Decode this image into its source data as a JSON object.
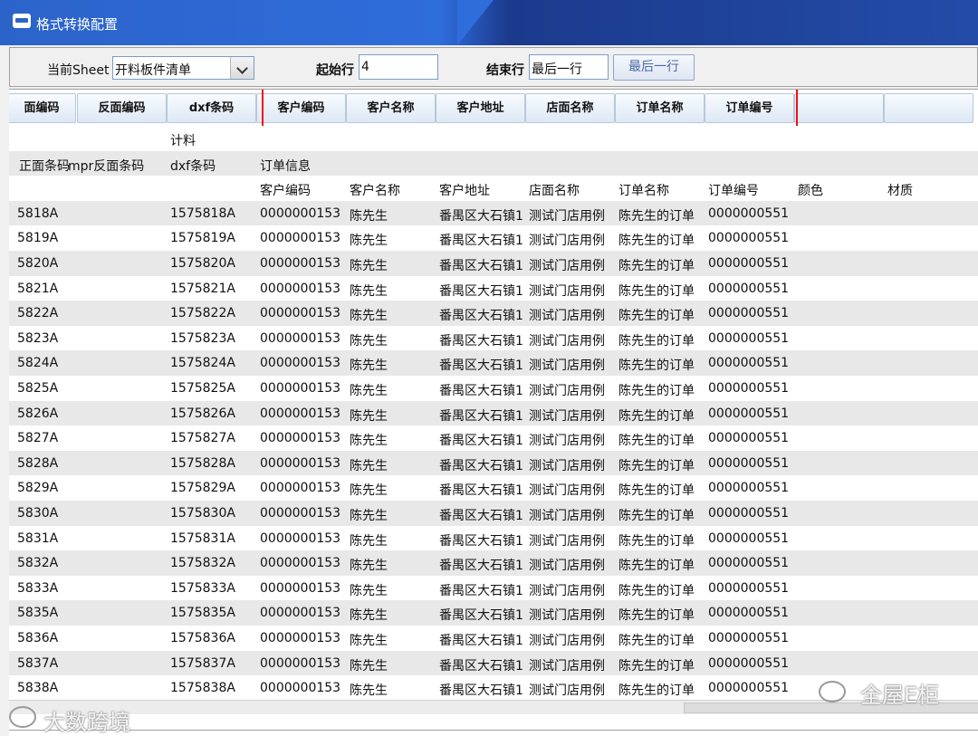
{
  "window": {
    "title": "格式转换配置"
  },
  "toolbar": {
    "sheet_label": "当前Sheet",
    "sheet_value": "开料板件清单",
    "start_label": "起始行",
    "start_value": "4",
    "end_label": "结束行",
    "end_value": "最后一行",
    "last_row_button": "最后一行"
  },
  "column_headers": [
    "面编码",
    "反面编码",
    "dxf条码",
    "客户编码",
    "客户名称",
    "客户地址",
    "店面名称",
    "订单名称",
    "订单编号",
    "",
    ""
  ],
  "header_rows": {
    "row1": {
      "c3": "计料"
    },
    "row2": {
      "c1": "正面条码",
      "c2": "mpr反面条码",
      "c3": "dxf条码",
      "c4": "订单信息"
    },
    "row3": {
      "c4": "客户编码",
      "c5": "客户名称",
      "c6": "客户地址",
      "c7": "店面名称",
      "c8": "订单名称",
      "c9": "订单编号",
      "c10": "颜色",
      "c11": "材质"
    }
  },
  "rows": [
    {
      "a": "5818A",
      "dxf": "1575818A",
      "cust_code": "0000000153",
      "cust_name": "陈先生",
      "addr": "番禺区大石镇1",
      "store": "测试门店用例",
      "order_name": "陈先生的订单",
      "order_no": "0000000551"
    },
    {
      "a": "5819A",
      "dxf": "1575819A",
      "cust_code": "0000000153",
      "cust_name": "陈先生",
      "addr": "番禺区大石镇1",
      "store": "测试门店用例",
      "order_name": "陈先生的订单",
      "order_no": "0000000551"
    },
    {
      "a": "5820A",
      "dxf": "1575820A",
      "cust_code": "0000000153",
      "cust_name": "陈先生",
      "addr": "番禺区大石镇1",
      "store": "测试门店用例",
      "order_name": "陈先生的订单",
      "order_no": "0000000551"
    },
    {
      "a": "5821A",
      "dxf": "1575821A",
      "cust_code": "0000000153",
      "cust_name": "陈先生",
      "addr": "番禺区大石镇1",
      "store": "测试门店用例",
      "order_name": "陈先生的订单",
      "order_no": "0000000551"
    },
    {
      "a": "5822A",
      "dxf": "1575822A",
      "cust_code": "0000000153",
      "cust_name": "陈先生",
      "addr": "番禺区大石镇1",
      "store": "测试门店用例",
      "order_name": "陈先生的订单",
      "order_no": "0000000551"
    },
    {
      "a": "5823A",
      "dxf": "1575823A",
      "cust_code": "0000000153",
      "cust_name": "陈先生",
      "addr": "番禺区大石镇1",
      "store": "测试门店用例",
      "order_name": "陈先生的订单",
      "order_no": "0000000551"
    },
    {
      "a": "5824A",
      "dxf": "1575824A",
      "cust_code": "0000000153",
      "cust_name": "陈先生",
      "addr": "番禺区大石镇1",
      "store": "测试门店用例",
      "order_name": "陈先生的订单",
      "order_no": "0000000551"
    },
    {
      "a": "5825A",
      "dxf": "1575825A",
      "cust_code": "0000000153",
      "cust_name": "陈先生",
      "addr": "番禺区大石镇1",
      "store": "测试门店用例",
      "order_name": "陈先生的订单",
      "order_no": "0000000551"
    },
    {
      "a": "5826A",
      "dxf": "1575826A",
      "cust_code": "0000000153",
      "cust_name": "陈先生",
      "addr": "番禺区大石镇1",
      "store": "测试门店用例",
      "order_name": "陈先生的订单",
      "order_no": "0000000551"
    },
    {
      "a": "5827A",
      "dxf": "1575827A",
      "cust_code": "0000000153",
      "cust_name": "陈先生",
      "addr": "番禺区大石镇1",
      "store": "测试门店用例",
      "order_name": "陈先生的订单",
      "order_no": "0000000551"
    },
    {
      "a": "5828A",
      "dxf": "1575828A",
      "cust_code": "0000000153",
      "cust_name": "陈先生",
      "addr": "番禺区大石镇1",
      "store": "测试门店用例",
      "order_name": "陈先生的订单",
      "order_no": "0000000551"
    },
    {
      "a": "5829A",
      "dxf": "1575829A",
      "cust_code": "0000000153",
      "cust_name": "陈先生",
      "addr": "番禺区大石镇1",
      "store": "测试门店用例",
      "order_name": "陈先生的订单",
      "order_no": "0000000551"
    },
    {
      "a": "5830A",
      "dxf": "1575830A",
      "cust_code": "0000000153",
      "cust_name": "陈先生",
      "addr": "番禺区大石镇1",
      "store": "测试门店用例",
      "order_name": "陈先生的订单",
      "order_no": "0000000551"
    },
    {
      "a": "5831A",
      "dxf": "1575831A",
      "cust_code": "0000000153",
      "cust_name": "陈先生",
      "addr": "番禺区大石镇1",
      "store": "测试门店用例",
      "order_name": "陈先生的订单",
      "order_no": "0000000551"
    },
    {
      "a": "5832A",
      "dxf": "1575832A",
      "cust_code": "0000000153",
      "cust_name": "陈先生",
      "addr": "番禺区大石镇1",
      "store": "测试门店用例",
      "order_name": "陈先生的订单",
      "order_no": "0000000551"
    },
    {
      "a": "5833A",
      "dxf": "1575833A",
      "cust_code": "0000000153",
      "cust_name": "陈先生",
      "addr": "番禺区大石镇1",
      "store": "测试门店用例",
      "order_name": "陈先生的订单",
      "order_no": "0000000551"
    },
    {
      "a": "5835A",
      "dxf": "1575835A",
      "cust_code": "0000000153",
      "cust_name": "陈先生",
      "addr": "番禺区大石镇1",
      "store": "测试门店用例",
      "order_name": "陈先生的订单",
      "order_no": "0000000551"
    },
    {
      "a": "5836A",
      "dxf": "1575836A",
      "cust_code": "0000000153",
      "cust_name": "陈先生",
      "addr": "番禺区大石镇1",
      "store": "测试门店用例",
      "order_name": "陈先生的订单",
      "order_no": "0000000551"
    },
    {
      "a": "5837A",
      "dxf": "1575837A",
      "cust_code": "0000000153",
      "cust_name": "陈先生",
      "addr": "番禺区大石镇1",
      "store": "测试门店用例",
      "order_name": "陈先生的订单",
      "order_no": "0000000551"
    },
    {
      "a": "5838A",
      "dxf": "1575838A",
      "cust_code": "0000000153",
      "cust_name": "陈先生",
      "addr": "番禺区大石镇1",
      "store": "测试门店用例",
      "order_name": "陈先生的订单",
      "order_no": "0000000551"
    }
  ],
  "watermarks": {
    "left": "大数跨境",
    "right": "全屋E柜"
  },
  "colors": {
    "highlight": "#e11111",
    "titlebar": "#2b63c9"
  }
}
